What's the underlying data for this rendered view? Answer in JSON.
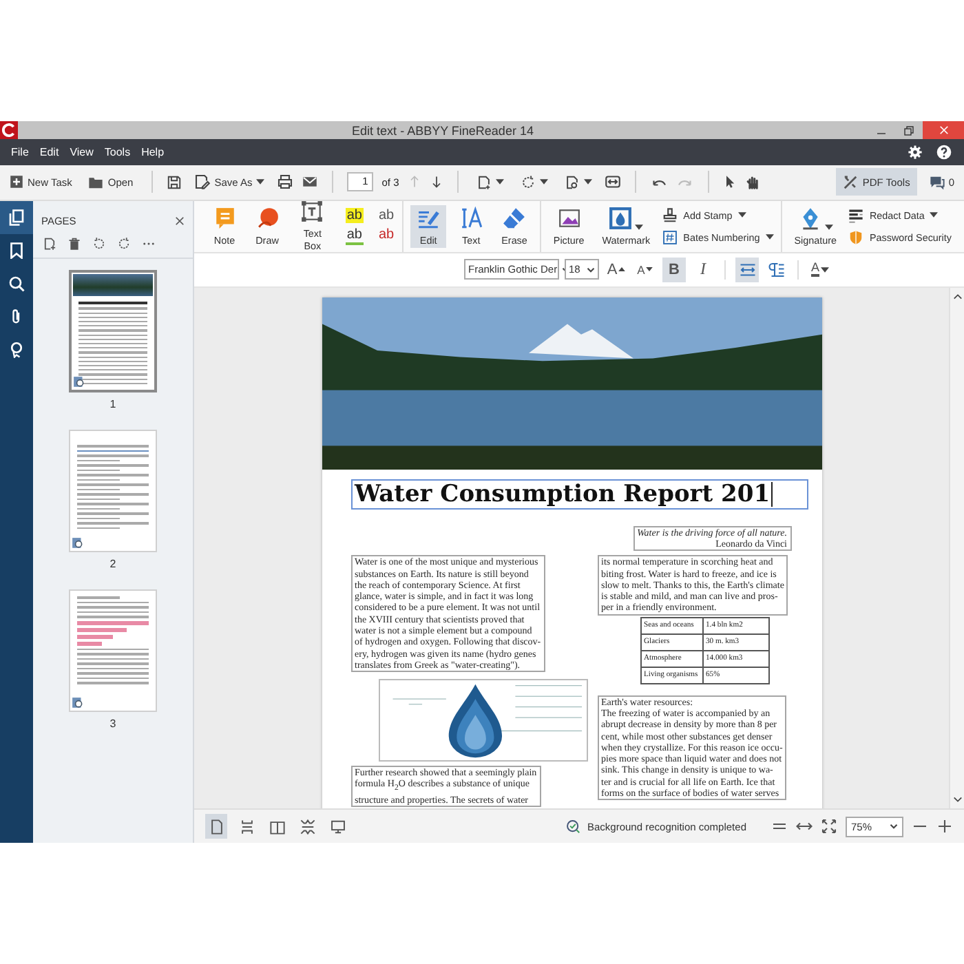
{
  "window": {
    "title": "Edit text - ABBYY FineReader 14"
  },
  "menu": [
    "File",
    "Edit",
    "View",
    "Tools",
    "Help"
  ],
  "toolbar": {
    "new_task": "New Task",
    "open": "Open",
    "save_as": "Save As",
    "page_number": "1",
    "page_count": "of 3",
    "previous_page": {
      "disabled": true
    },
    "next_page": {
      "disabled": false
    },
    "undo": {
      "disabled": false
    },
    "redo": {
      "disabled": true
    },
    "pdf_tools": {
      "label": "PDF Tools",
      "selected": true
    },
    "comments_count": "0"
  },
  "rail": [
    {
      "selected": true
    },
    {
      "selected": false
    },
    {
      "selected": false
    },
    {
      "selected": false
    },
    {
      "selected": false
    }
  ],
  "pages_panel": {
    "title": "PAGES",
    "pages": [
      {
        "label": "1",
        "selected": true
      },
      {
        "label": "2",
        "selected": false
      },
      {
        "label": "3",
        "selected": false
      }
    ]
  },
  "ribbon": {
    "groups": [
      {
        "tools": [
          {
            "kind": "big",
            "label": "Note",
            "selected": false,
            "dropdown": false
          },
          {
            "kind": "big",
            "label": "Draw",
            "selected": false,
            "dropdown": false
          },
          {
            "kind": "big",
            "label": "Text Box",
            "selected": false,
            "dropdown": false
          },
          {
            "kind": "markup",
            "items": [
              {
                "kind": "highlight",
                "glyph": "ab"
              },
              {
                "kind": "insert",
                "glyph": "ab"
              },
              {
                "kind": "underline",
                "glyph": "ab"
              },
              {
                "kind": "strikeout",
                "glyph": "ab"
              }
            ]
          }
        ]
      },
      {
        "tools": [
          {
            "kind": "big",
            "label": "Edit",
            "selected": true,
            "dropdown": false
          },
          {
            "kind": "big",
            "label": "Text",
            "selected": false,
            "dropdown": false
          },
          {
            "kind": "big",
            "label": "Erase",
            "selected": false,
            "dropdown": false
          }
        ]
      },
      {
        "tools": [
          {
            "kind": "big",
            "label": "Picture",
            "selected": false,
            "dropdown": false
          },
          {
            "kind": "big",
            "label": "Watermark",
            "selected": false,
            "dropdown": true
          },
          {
            "kind": "stack",
            "items": [
              {
                "label": "Add Stamp",
                "dropdown": true
              },
              {
                "label": "Bates Numbering",
                "dropdown": true
              }
            ]
          }
        ]
      },
      {
        "tools": [
          {
            "kind": "big",
            "label": "Signature",
            "selected": false,
            "dropdown": true
          },
          {
            "kind": "stack",
            "items": [
              {
                "label": "Redact Data",
                "dropdown": true
              },
              {
                "label": "Password Security",
                "dropdown": false
              }
            ]
          }
        ]
      }
    ]
  },
  "format_bar": {
    "font": "Franklin Gothic Der",
    "size": "18",
    "buttons": [
      {
        "kind": "grow",
        "glyph": "A",
        "selected": false
      },
      {
        "kind": "shrink",
        "glyph": "A",
        "selected": false
      },
      {
        "kind": "bold",
        "glyph": "B",
        "selected": true
      },
      {
        "kind": "italic",
        "glyph": "I",
        "selected": false
      },
      {
        "kind": "fit",
        "selected": true
      },
      {
        "kind": "paragraph",
        "selected": false
      },
      {
        "kind": "color",
        "glyph": "A",
        "selected": false
      }
    ]
  },
  "document": {
    "title": "Water Consumption Report 201",
    "quote": {
      "text": "Water is the driving force of all nature.",
      "author": "Leonardo da Vinci"
    },
    "left_column": [
      {
        "kind": "text",
        "lines": [
          "Water is one of the most unique and mysterious",
          "substances on Earth. Its nature is still beyond",
          "the reach of contemporary Science. At first",
          "glance, water is simple, and in fact it was long",
          "considered to be a pure element. It was not until",
          "the XVIII century that scientists proved that",
          "water is not a simple element but a compound",
          "of hydrogen and oxygen. Following that discov-",
          "ery, hydrogen was given its name (hydro genes",
          "translates from Greek as \"water-creating\")."
        ]
      },
      {
        "kind": "figure"
      },
      {
        "kind": "text",
        "lines": [
          "Further research showed that a seemingly plain",
          "formula H$_{2}$O describes a substance of unique",
          "structure and properties. The secrets of water"
        ]
      }
    ],
    "right_column": [
      {
        "kind": "text",
        "lines": [
          "its normal temperature in scorching heat and",
          "biting frost. Water is hard to freeze, and ice is",
          "slow to melt. Thanks to this, the Earth's climate",
          "is stable and mild, and man can live and pros-",
          "per in a friendly environment."
        ]
      },
      {
        "kind": "table",
        "rows": [
          [
            "Seas and oceans",
            "1.4 bln km2"
          ],
          [
            "Glaciers",
            "30 m. km3"
          ],
          [
            "Atmosphere",
            "14.000 km3"
          ],
          [
            "Living organisms",
            "65%"
          ]
        ]
      },
      {
        "kind": "text",
        "lines": [
          "Earth's water resources:",
          "The freezing of water is accompanied by an",
          "abrupt decrease in density by more than 8 per",
          "cent, while most other substances get denser",
          "when they crystallize. For this reason ice occu-",
          "pies more space than liquid water and does not",
          "sink. This change in density is unique to wa-",
          "ter and is crucial for all life on Earth. Ice that",
          "forms on the surface of bodies of water serves"
        ]
      }
    ]
  },
  "status_bar": {
    "views": [
      {
        "selected": true
      },
      {
        "selected": false
      },
      {
        "selected": false
      },
      {
        "selected": false
      },
      {
        "selected": false
      }
    ],
    "message": "Background recognition completed",
    "zoom": "75%"
  }
}
